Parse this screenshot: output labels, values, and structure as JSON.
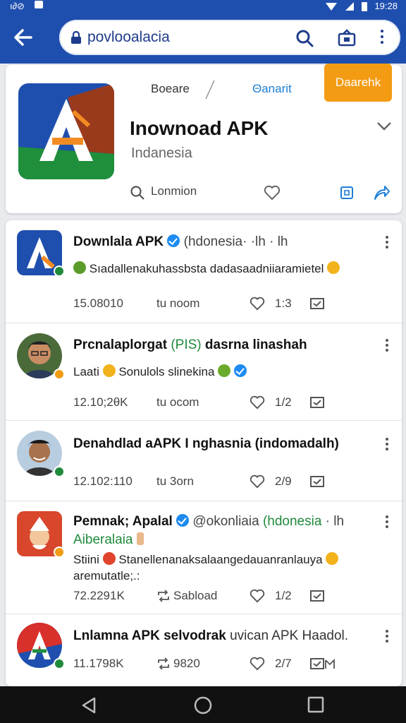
{
  "status": {
    "time": "19:28",
    "left_icons": [
      "ı∂⊘"
    ]
  },
  "browser": {
    "url": "povlooalacia"
  },
  "app": {
    "tab_left": "Boeare",
    "tab_right": "Θanarit",
    "orange_button": "Daarehk",
    "title": "Inownoad APK",
    "subtitle": "Indanesia",
    "search_label": "Lonmion"
  },
  "posts": [
    {
      "name": "Downlala APK",
      "meta": "(hdonesia· ·lh · lh",
      "text": "Sıadallenakuhassbsta dadasaadniiaramietel",
      "s1": "15.08010",
      "s2": "tu noom",
      "s3": "1:3"
    },
    {
      "name": "Prcnalaplorgat",
      "meta_green": "(PIS)",
      "meta": "dasrna linashah",
      "text_pre": "Laati",
      "text": "Sonulols slinekina",
      "s1": "12.10;2θK",
      "s2": "tu ocom",
      "s3": "1/2"
    },
    {
      "name": "Denahdlad aAPK I nghasnia (indomadalh)",
      "s1": "12.102:110",
      "s2": "tu 3orn",
      "s3": "2/9"
    },
    {
      "name": "Pemnak; Apalal",
      "meta": "@okonliaia",
      "meta_green": "(hdonesia",
      "meta_tail": "· lh",
      "text_green": "Aiberalaia",
      "text_pre": "Stiini",
      "text": "Stanellenanaksalaangedauanranlauya",
      "text2": "aremutatle;.:",
      "s1": "72.2291K",
      "s2": "Sabload",
      "s3": "1/2"
    },
    {
      "name": "Lnlamna APK selvodrak",
      "meta": "uvican APK Haadol.",
      "s1": "11.1798K",
      "s2": "9820",
      "s3": "2/7"
    }
  ],
  "colors": {
    "appbar": "#1f4fae",
    "accent": "#1d8bf1",
    "orange": "#f39b12",
    "green": "#1f8a3c"
  }
}
